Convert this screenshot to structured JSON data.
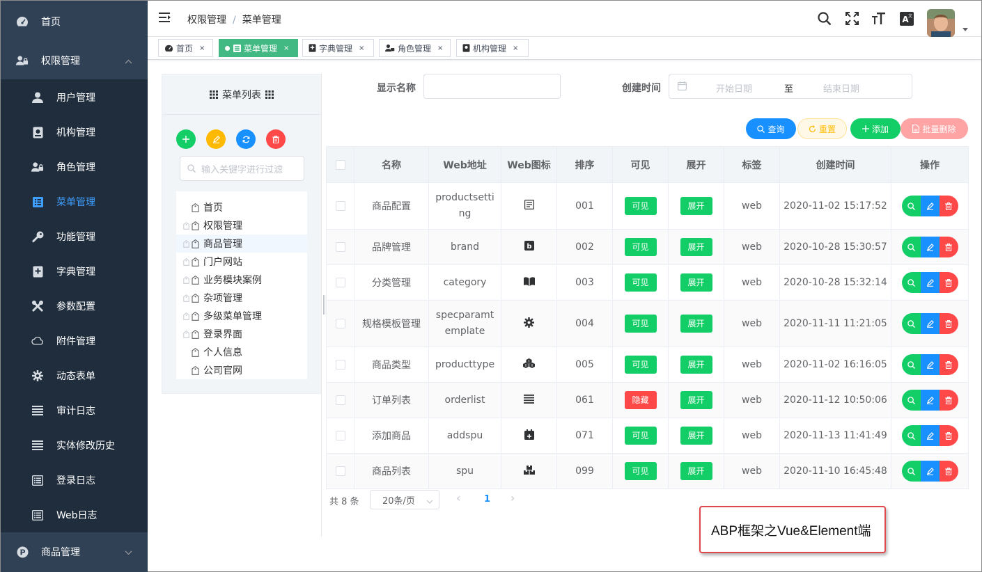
{
  "sidebar": {
    "items": [
      {
        "label": "首页",
        "icon": "dashboard-icon"
      },
      {
        "label": "权限管理",
        "icon": "user-lock-icon"
      },
      {
        "label": "用户管理",
        "icon": "user-icon"
      },
      {
        "label": "机构管理",
        "icon": "org-icon"
      },
      {
        "label": "角色管理",
        "icon": "role-icon"
      },
      {
        "label": "菜单管理",
        "icon": "menu-icon"
      },
      {
        "label": "功能管理",
        "icon": "key-icon"
      },
      {
        "label": "字典管理",
        "icon": "dict-icon"
      },
      {
        "label": "参数配置",
        "icon": "tools-icon"
      },
      {
        "label": "附件管理",
        "icon": "cloud-icon"
      },
      {
        "label": "动态表单",
        "icon": "gear-icon"
      },
      {
        "label": "审计日志",
        "icon": "list-icon"
      },
      {
        "label": "实体修改历史",
        "icon": "list-icon"
      },
      {
        "label": "登录日志",
        "icon": "log-icon"
      },
      {
        "label": "Web日志",
        "icon": "log-icon"
      },
      {
        "label": "商品管理",
        "icon": "product-icon"
      }
    ]
  },
  "header": {
    "breadcrumb": [
      "权限管理",
      "菜单管理"
    ],
    "breadcrumb_sep": "/"
  },
  "tags": [
    {
      "label": "首页",
      "close": "×"
    },
    {
      "label": "菜单管理",
      "close": "×"
    },
    {
      "label": "字典管理",
      "close": "×"
    },
    {
      "label": "角色管理",
      "close": "×"
    },
    {
      "label": "机构管理",
      "close": "×"
    }
  ],
  "tree": {
    "title": "菜单列表",
    "search_placeholder": "输入关键字进行过滤",
    "nodes": [
      {
        "label": "首页",
        "expandable": false
      },
      {
        "label": "权限管理",
        "expandable": true
      },
      {
        "label": "商品管理",
        "expandable": true,
        "selected": true
      },
      {
        "label": "门户网站",
        "expandable": true
      },
      {
        "label": "业务模块案例",
        "expandable": true
      },
      {
        "label": "杂项管理",
        "expandable": true
      },
      {
        "label": "多级菜单管理",
        "expandable": true
      },
      {
        "label": "登录界面",
        "expandable": true
      },
      {
        "label": "个人信息",
        "expandable": false
      },
      {
        "label": "公司官网",
        "expandable": false
      }
    ]
  },
  "filter": {
    "name_label": "显示名称",
    "name_value": "",
    "time_label": "创建时间",
    "start_placeholder": "开始日期",
    "range_sep": "至",
    "end_placeholder": "结束日期"
  },
  "buttons": {
    "query": "查询",
    "reset": "重置",
    "add": "添加",
    "batch_delete": "批量删除"
  },
  "table": {
    "headers": [
      "名称",
      "Web地址",
      "Web图标",
      "排序",
      "可见",
      "展开",
      "标签",
      "创建时间",
      "操作"
    ],
    "rows": [
      {
        "name": "商品配置",
        "url": "productsetting",
        "icon": "form-icon",
        "sort": "001",
        "visible": "可见",
        "expand": "展开",
        "tag": "web",
        "time": "2020-11-02 15:17:52"
      },
      {
        "name": "品牌管理",
        "url": "brand",
        "icon": "brand-icon",
        "sort": "002",
        "visible": "可见",
        "expand": "展开",
        "tag": "web",
        "time": "2020-10-28 15:30:57"
      },
      {
        "name": "分类管理",
        "url": "category",
        "icon": "book-icon",
        "sort": "003",
        "visible": "可见",
        "expand": "展开",
        "tag": "web",
        "time": "2020-10-28 15:32:14"
      },
      {
        "name": "规格模板管理",
        "url": "specparamtemplate",
        "icon": "cog-icon",
        "sort": "004",
        "visible": "可见",
        "expand": "展开",
        "tag": "web",
        "time": "2020-11-11 11:21:05"
      },
      {
        "name": "商品类型",
        "url": "producttype",
        "icon": "cubes-icon",
        "sort": "005",
        "visible": "可见",
        "expand": "展开",
        "tag": "web",
        "time": "2020-11-02 16:16:05"
      },
      {
        "name": "订单列表",
        "url": "orderlist",
        "icon": "list-icon",
        "sort": "061",
        "visible": "隐藏",
        "expand": "展开",
        "tag": "web",
        "time": "2020-11-12 10:50:06"
      },
      {
        "name": "添加商品",
        "url": "addspu",
        "icon": "calendar-plus-icon",
        "sort": "071",
        "visible": "可见",
        "expand": "展开",
        "tag": "web",
        "time": "2020-11-13 11:41:49"
      },
      {
        "name": "商品列表",
        "url": "spu",
        "icon": "boxes-icon",
        "sort": "099",
        "visible": "可见",
        "expand": "展开",
        "tag": "web",
        "time": "2020-11-10 16:45:48"
      }
    ]
  },
  "pagination": {
    "total": "共 8 条",
    "page_size": "20条/页",
    "prev": "‹",
    "current": "1",
    "next": "›"
  },
  "callout": "ABP框架之Vue&Element端",
  "colors": {
    "sidebar_bg": "#304156",
    "sidebar_sub_bg": "#1f2d3d",
    "active_blue": "#409eff",
    "green": "#13ce66",
    "red": "#ff4949",
    "primary": "#1890ff",
    "tag_active": "#42b983"
  }
}
